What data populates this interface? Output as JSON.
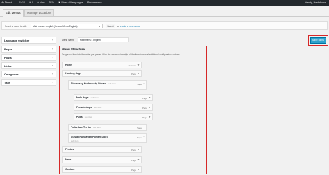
{
  "admin_bar": {
    "site_name": "My Dienst",
    "updates": "10",
    "comments": "0",
    "new_label": "+ New",
    "seo": "SEO",
    "languages": "Show all languages",
    "performance": "Performance",
    "greeting": "Howdy, Heidehorse"
  },
  "tabs": [
    {
      "label": "Edit Menus"
    },
    {
      "label": "Manage Locations"
    }
  ],
  "select_bar": {
    "label": "Select a menu to edit:",
    "selected": "Main menu - english (Header Menu English)",
    "select_button": "Select",
    "or_text": "or",
    "create_link": "create a new menu"
  },
  "sidebar": [
    {
      "label": "Language switcher"
    },
    {
      "label": "Pages"
    },
    {
      "label": "Posts"
    },
    {
      "label": "Links"
    },
    {
      "label": "Categories"
    },
    {
      "label": "Tags"
    }
  ],
  "menu_name": {
    "label": "Menu Name",
    "value": "Main menu - english"
  },
  "save_button": "Save Menu",
  "structure": {
    "title": "Menu Structure",
    "description": "Drag each item into the order you prefer. Click the arrow on the right of the item to reveal additional configuration options."
  },
  "menu_items": [
    {
      "title": "Home",
      "sub": "",
      "type": "Custom"
    },
    {
      "title": "Hunting dogs",
      "sub": "",
      "type": "Page"
    },
    {
      "title": "Slovensky Hrubosrsty Stavac",
      "sub": "sub item",
      "type": "Page"
    },
    {
      "title": "Male dogs",
      "sub": "sub item",
      "type": "Page"
    },
    {
      "title": "Female dogs",
      "sub": "sub item",
      "type": "Page"
    },
    {
      "title": "Pups",
      "sub": "sub item",
      "type": "Page"
    },
    {
      "title": "Pallardale Terrier",
      "sub": "sub item",
      "type": "Page"
    },
    {
      "title": "Vizsla (Hungarian Pointer Dog)",
      "sub": "sub item",
      "type": "Page"
    },
    {
      "title": "Photos",
      "sub": "",
      "type": "Page"
    },
    {
      "title": "News",
      "sub": "",
      "type": "Page"
    },
    {
      "title": "Contact",
      "sub": "",
      "type": "Page"
    }
  ],
  "colors": {
    "admin_bar": "#23282d",
    "highlight": "#d62828",
    "primary_button": "#2ea2cc",
    "link": "#0073aa"
  }
}
